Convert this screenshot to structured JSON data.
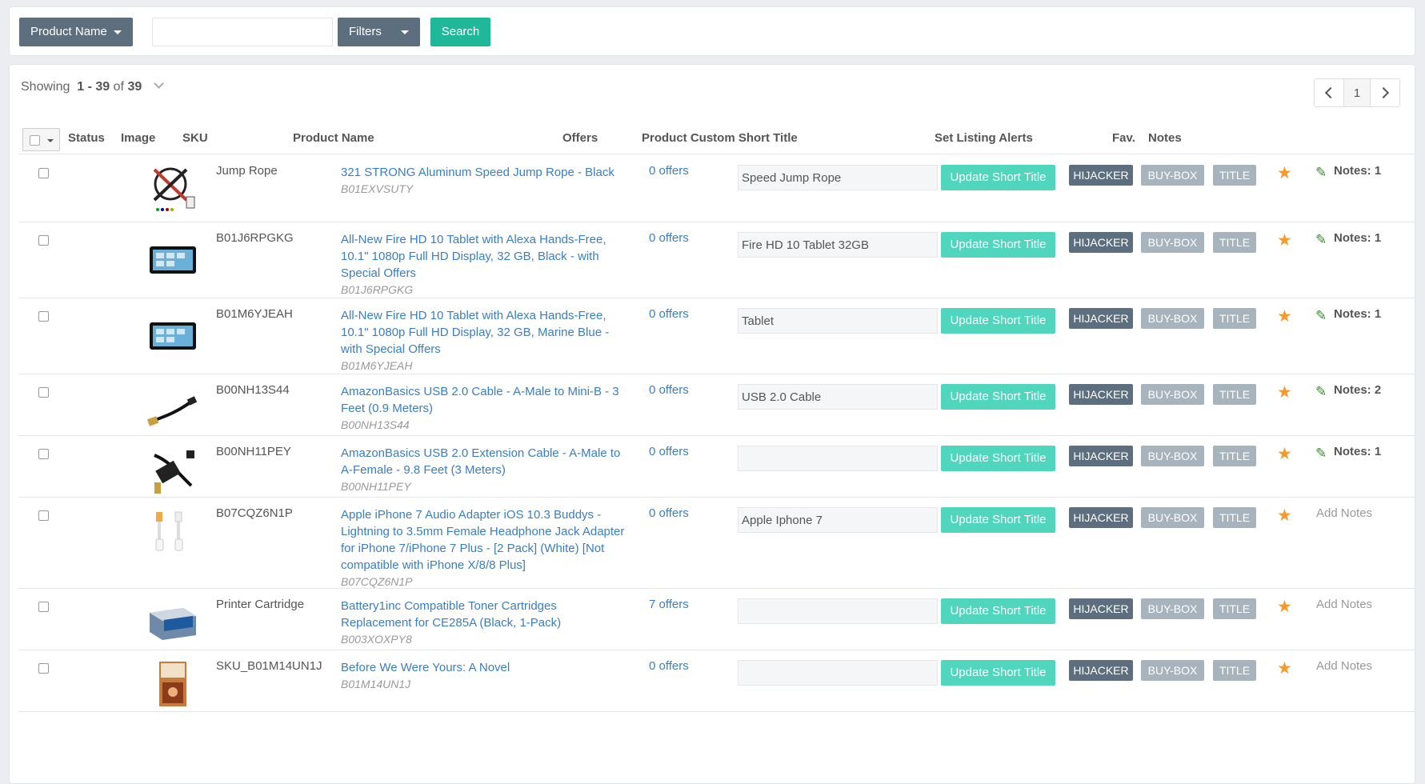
{
  "search": {
    "field_label": "Product Name",
    "input_value": "",
    "filters_label": "Filters",
    "search_label": "Search"
  },
  "listing": {
    "showing_prefix": "Showing",
    "showing_range": "1 - 39",
    "showing_of": "of",
    "showing_total": "39",
    "page": "1"
  },
  "columns": {
    "status": "Status",
    "image": "Image",
    "sku": "SKU",
    "product_name": "Product Name",
    "offers": "Offers",
    "short_title": "Product Custom Short Title",
    "alerts": "Set Listing Alerts",
    "fav": "Fav.",
    "notes": "Notes"
  },
  "labels": {
    "update": "Update Short Title",
    "hijacker": "HIJACKER",
    "buybox": "BUY-BOX",
    "title": "TITLE"
  },
  "rows": [
    {
      "sku": "Jump Rope",
      "name": "321 STRONG Aluminum Speed Jump Rope - Black",
      "asin": "B01EXVSUTY",
      "offers": "0 offers",
      "short_title": "Speed Jump Rope",
      "notes": "Notes: 1",
      "has_notes": true,
      "image": "jump-rope-image"
    },
    {
      "sku": "B01J6RPGKG",
      "name": "All-New Fire HD 10 Tablet with Alexa Hands-Free, 10.1\" 1080p Full HD Display, 32 GB, Black - with Special Offers",
      "asin": "B01J6RPGKG",
      "offers": "0 offers",
      "short_title": "Fire HD 10 Tablet 32GB",
      "notes": "Notes: 1",
      "has_notes": true,
      "image": "tablet-image"
    },
    {
      "sku": "B01M6YJEAH",
      "name": "All-New Fire HD 10 Tablet with Alexa Hands-Free, 10.1\" 1080p Full HD Display, 32 GB, Marine Blue - with Special Offers",
      "asin": "B01M6YJEAH",
      "offers": "0 offers",
      "short_title": "Tablet",
      "notes": "Notes: 1",
      "has_notes": true,
      "image": "tablet-image"
    },
    {
      "sku": "B00NH13S44",
      "name": "AmazonBasics USB 2.0 Cable - A-Male to Mini-B - 3 Feet (0.9 Meters)",
      "asin": "B00NH13S44",
      "offers": "0 offers",
      "short_title": "USB 2.0 Cable",
      "notes": "Notes: 2",
      "has_notes": true,
      "image": "usb-cable-image"
    },
    {
      "sku": "B00NH11PEY",
      "name": "AmazonBasics USB 2.0 Extension Cable - A-Male to A-Female - 9.8 Feet (3 Meters)",
      "asin": "B00NH11PEY",
      "offers": "0 offers",
      "short_title": "",
      "notes": "Notes: 1",
      "has_notes": true,
      "image": "usb-extension-image"
    },
    {
      "sku": "B07CQZ6N1P",
      "name": "Apple iPhone 7 Audio Adapter iOS 10.3 Buddys - Lightning to 3.5mm Female Headphone Jack Adapter for iPhone 7/iPhone 7 Plus - [2 Pack] (White) [Not compatible with iPhone X/8/8 Plus]",
      "asin": "B07CQZ6N1P",
      "offers": "0 offers",
      "short_title": "Apple Iphone 7",
      "notes": "Add Notes",
      "has_notes": false,
      "image": "audio-adapter-image"
    },
    {
      "sku": "Printer Cartridge",
      "name": "Battery1inc Compatible Toner Cartridges Replacement for CE285A (Black, 1-Pack)",
      "asin": "B003XOXPY8",
      "offers": "7 offers",
      "short_title": "",
      "notes": "Add Notes",
      "has_notes": false,
      "image": "toner-image"
    },
    {
      "sku": "SKU_B01M14UN1J",
      "name": "Before We Were Yours: A Novel",
      "asin": "B01M14UN1J",
      "offers": "0 offers",
      "short_title": "",
      "notes": "Add Notes",
      "has_notes": false,
      "image": "book-image"
    }
  ],
  "colors": {
    "primary_dark": "#5d6f7e",
    "accent_green": "#1fb99a",
    "update_button": "#4fd6bd",
    "link_blue": "#3a7ec2",
    "star": "#f29a2e"
  }
}
